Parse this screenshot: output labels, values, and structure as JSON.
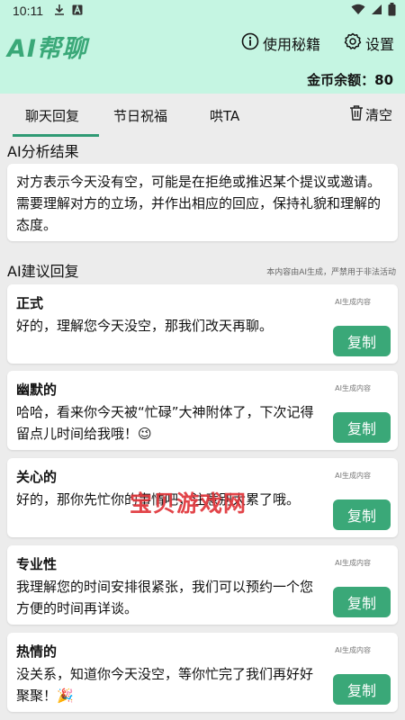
{
  "status_bar": {
    "time": "10:11",
    "download_icon": "download-icon",
    "a_icon": "a-icon",
    "wifi_icon": "wifi-icon",
    "signal_icon": "signal-icon",
    "battery_icon": "battery-icon"
  },
  "header": {
    "logo": "AI帮聊",
    "help_label": "使用秘籍",
    "help_icon": "info-icon",
    "settings_label": "设置",
    "settings_icon": "gear-icon",
    "coins": "金币余额：80"
  },
  "tabs": [
    {
      "label": "聊天回复",
      "active": true
    },
    {
      "label": "节日祝福",
      "active": false
    },
    {
      "label": "哄TA",
      "active": false
    }
  ],
  "clear": {
    "label": "清空",
    "icon": "trash-icon"
  },
  "analysis": {
    "title": "AI分析结果",
    "text": "对方表示今天没有空，可能是在拒绝或推迟某个提议或邀请。需要理解对方的立场，并作出相应的回应，保持礼貌和理解的态度。"
  },
  "suggestions": {
    "title": "AI建议回复",
    "note": "本内容由AI生成，严禁用于非法活动"
  },
  "replies": [
    {
      "style": "正式",
      "tag": "AI生成内容",
      "text": "好的，理解您今天没空，那我们改天再聊。",
      "copy": "复制"
    },
    {
      "style": "幽默的",
      "tag": "AI生成内容",
      "text": "哈哈，看来你今天被“忙碌”大神附体了，下次记得留点儿时间给我哦！😉",
      "copy": "复制"
    },
    {
      "style": "关心的",
      "tag": "AI生成内容",
      "text": "好的，那你先忙你的事情吧，注意别太累了哦。",
      "copy": "复制"
    },
    {
      "style": "专业性",
      "tag": "AI生成内容",
      "text": "我理解您的时间安排很紧张，我们可以预约一个您方便的时间再详谈。",
      "copy": "复制"
    },
    {
      "style": "热情的",
      "tag": "AI生成内容",
      "text": "没关系，知道你今天没空，等你忙完了我们再好好聚聚！🎉",
      "copy": "复制"
    }
  ],
  "watermark": "宝贝游戏网",
  "colors": {
    "header_bg": "#c5f5e2",
    "accent": "#3aa878",
    "page_bg": "#ececec"
  }
}
